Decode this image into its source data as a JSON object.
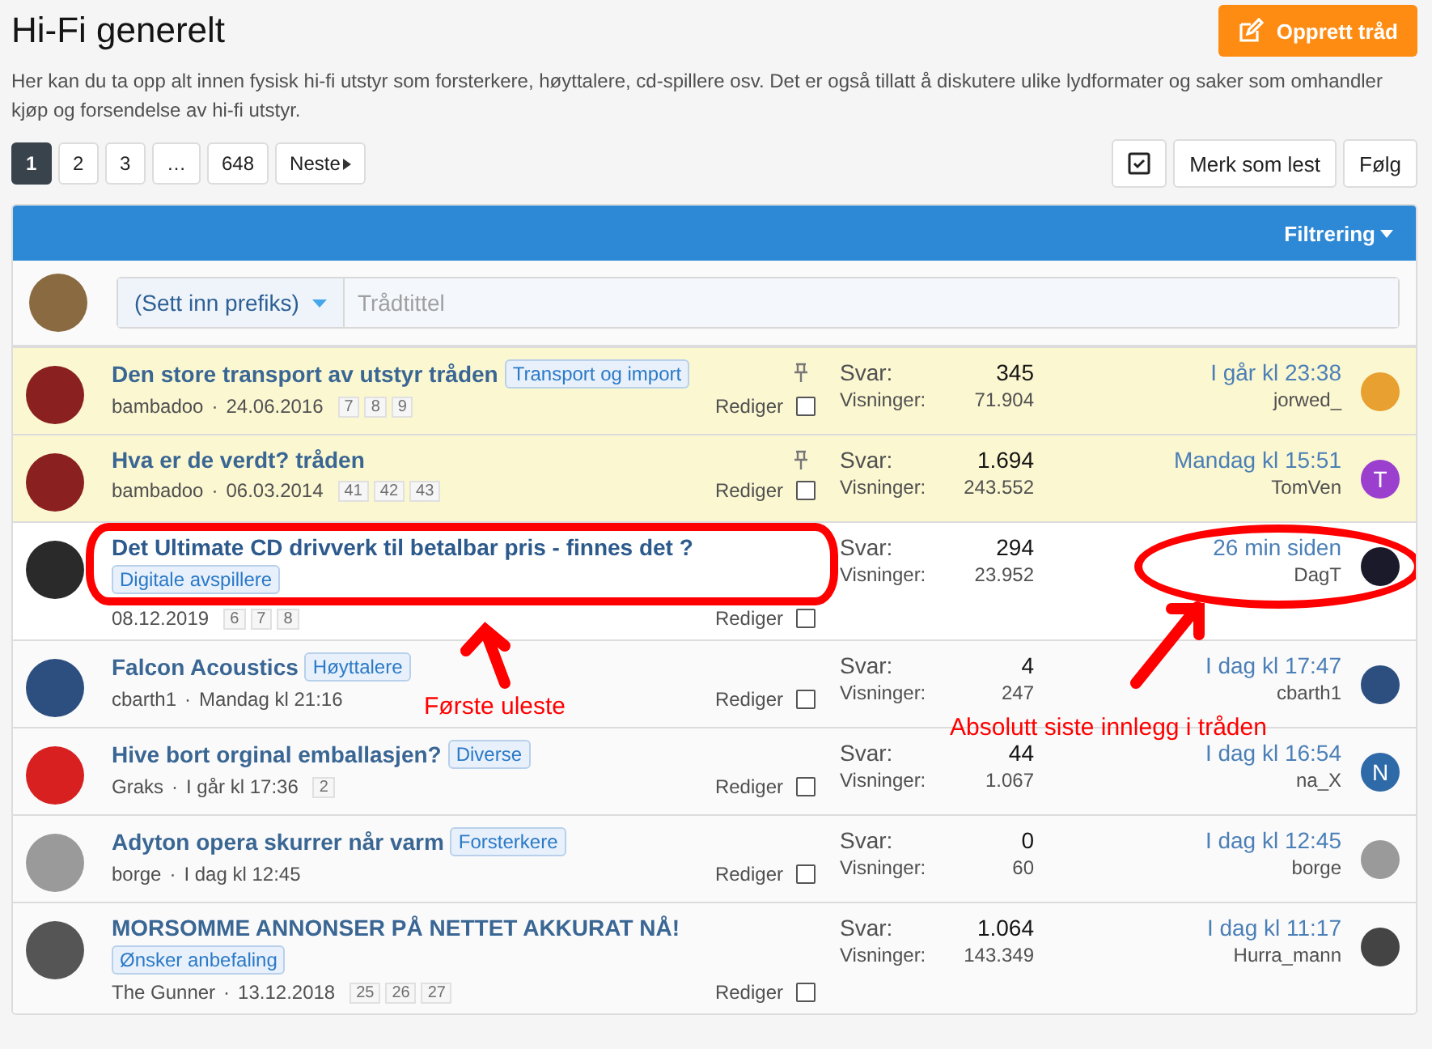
{
  "title": "Hi-Fi generelt",
  "create_button": "Opprett tråd",
  "description": "Her kan du ta opp alt innen fysisk hi-fi utstyr som forsterkere, høyttalere, cd-spillere osv. Det er også tillatt å diskutere ulike lydformater og saker som omhandler kjøp og forsendelse av hi-fi utstyr.",
  "pages": [
    {
      "label": "1",
      "selected": true
    },
    {
      "label": "2",
      "selected": false
    },
    {
      "label": "3",
      "selected": false
    },
    {
      "label": "…",
      "selected": false
    },
    {
      "label": "648",
      "selected": false
    }
  ],
  "next_button": "Neste",
  "mark_read_button": "Merk som lest",
  "follow_button": "Følg",
  "filter_button": "Filtrering",
  "new_thread": {
    "prefix": "(Sett inn prefiks)",
    "placeholder": "Trådtittel"
  },
  "byline_separator": "·",
  "threads": [
    {
      "title": "Den store transport av utstyr tråden",
      "tag": "Transport og import",
      "author": "bambadoo",
      "date": "24.06.2016",
      "pages": [
        "7",
        "8",
        "9"
      ],
      "sticky": true,
      "unread": false,
      "circled": false,
      "edit": "Rediger",
      "replies_label": "Svar:",
      "replies": "345",
      "views_label": "Visninger:",
      "views": "71.904",
      "last_time": "I går kl 23:38",
      "last_user": "jorwed_",
      "avatar": {
        "color": "#8a2020"
      },
      "last_avatar": {
        "color": "#e8a030"
      }
    },
    {
      "title": "Hva er de verdt? tråden",
      "author": "bambadoo",
      "date": "06.03.2014",
      "pages": [
        "41",
        "42",
        "43"
      ],
      "sticky": true,
      "unread": false,
      "circled": false,
      "edit": "Rediger",
      "replies_label": "Svar:",
      "replies": "1.694",
      "views_label": "Visninger:",
      "views": "243.552",
      "last_time": "Mandag kl 15:51",
      "last_user": "TomVen",
      "avatar": {
        "color": "#8a2020"
      },
      "last_avatar": {
        "color": "#9b3fcf",
        "letter": "T"
      }
    },
    {
      "title": "Det Ultimate CD drivverk til betalbar pris - finnes det ?",
      "tag": "Digitale avspillere",
      "date": "08.12.2019",
      "pages": [
        "6",
        "7",
        "8"
      ],
      "sticky": false,
      "unread": true,
      "circled": true,
      "edit": "Rediger",
      "replies_label": "Svar:",
      "replies": "294",
      "views_label": "Visninger:",
      "views": "23.952",
      "last_time": "26 min siden",
      "last_user": "DagT",
      "avatar": {
        "color": "#2a2a2a"
      },
      "last_avatar": {
        "color": "#1a1a2a"
      }
    },
    {
      "title": "Falcon Acoustics",
      "tag": "Høyttalere",
      "author": "cbarth1",
      "date": "Mandag kl 21:16",
      "sticky": false,
      "unread": false,
      "circled": false,
      "edit": "Rediger",
      "replies_label": "Svar:",
      "replies": "4",
      "views_label": "Visninger:",
      "views": "247",
      "last_time": "I dag kl 17:47",
      "last_user": "cbarth1",
      "avatar": {
        "color": "#2c4f80"
      },
      "last_avatar": {
        "color": "#2c4f80"
      }
    },
    {
      "title": "Hive bort orginal emballasjen?",
      "tag": "Diverse",
      "author": "Graks",
      "date": "I går kl 17:36",
      "pages": [
        "2"
      ],
      "sticky": false,
      "unread": false,
      "circled": false,
      "edit": "Rediger",
      "replies_label": "Svar:",
      "replies": "44",
      "views_label": "Visninger:",
      "views": "1.067",
      "last_time": "I dag kl 16:54",
      "last_user": "na_X",
      "avatar": {
        "color": "#d82020"
      },
      "last_avatar": {
        "color": "#2f6aa8",
        "letter": "N"
      }
    },
    {
      "title": "Adyton opera skurrer når varm",
      "tag": "Forsterkere",
      "author": "borge",
      "date": "I dag kl 12:45",
      "sticky": false,
      "unread": false,
      "circled": false,
      "edit": "Rediger",
      "replies_label": "Svar:",
      "replies": "0",
      "views_label": "Visninger:",
      "views": "60",
      "last_time": "I dag kl 12:45",
      "last_user": "borge",
      "avatar": {
        "color": "#9a9a9a"
      },
      "last_avatar": {
        "color": "#9a9a9a"
      }
    },
    {
      "title": "MORSOMME ANNONSER PÅ NETTET AKKURAT NÅ!",
      "tag": "Ønsker anbefaling",
      "author": "The Gunner",
      "date": "13.12.2018",
      "pages": [
        "25",
        "26",
        "27"
      ],
      "sticky": false,
      "unread": false,
      "circled": false,
      "edit": "Rediger",
      "replies_label": "Svar:",
      "replies": "1.064",
      "views_label": "Visninger:",
      "views": "143.349",
      "last_time": "I dag kl 11:17",
      "last_user": "Hurra_mann",
      "avatar": {
        "color": "#555555"
      },
      "last_avatar": {
        "color": "#444444"
      }
    }
  ],
  "annotations": [
    "Første uleste",
    "Absolutt siste innlegg i tråden"
  ]
}
